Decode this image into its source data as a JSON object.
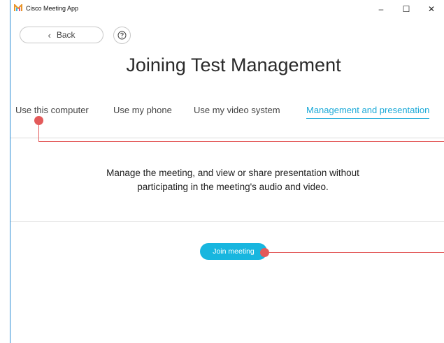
{
  "window": {
    "title": "Cisco Meeting App",
    "controls": {
      "minimize": "–",
      "maximize": "☐",
      "close": "✕"
    }
  },
  "toolbar": {
    "back_label": "Back",
    "back_icon": "chevron-left-icon",
    "help_icon": "question-circle-icon"
  },
  "main": {
    "title": "Joining Test Management",
    "tabs": [
      {
        "label": "Use this computer",
        "active": false
      },
      {
        "label": "Use my phone",
        "active": false
      },
      {
        "label": "Use my video system",
        "active": false
      },
      {
        "label": "Management and presentation",
        "active": true
      }
    ],
    "description_line1": "Manage the meeting, and view or share presentation without",
    "description_line2": "participating in the meeting's audio and video.",
    "join_label": "Join meeting"
  },
  "colors": {
    "accent": "#1aa9d8",
    "button": "#18b6df",
    "callout": "#e35a5a",
    "window_border": "#2f8fd6"
  }
}
